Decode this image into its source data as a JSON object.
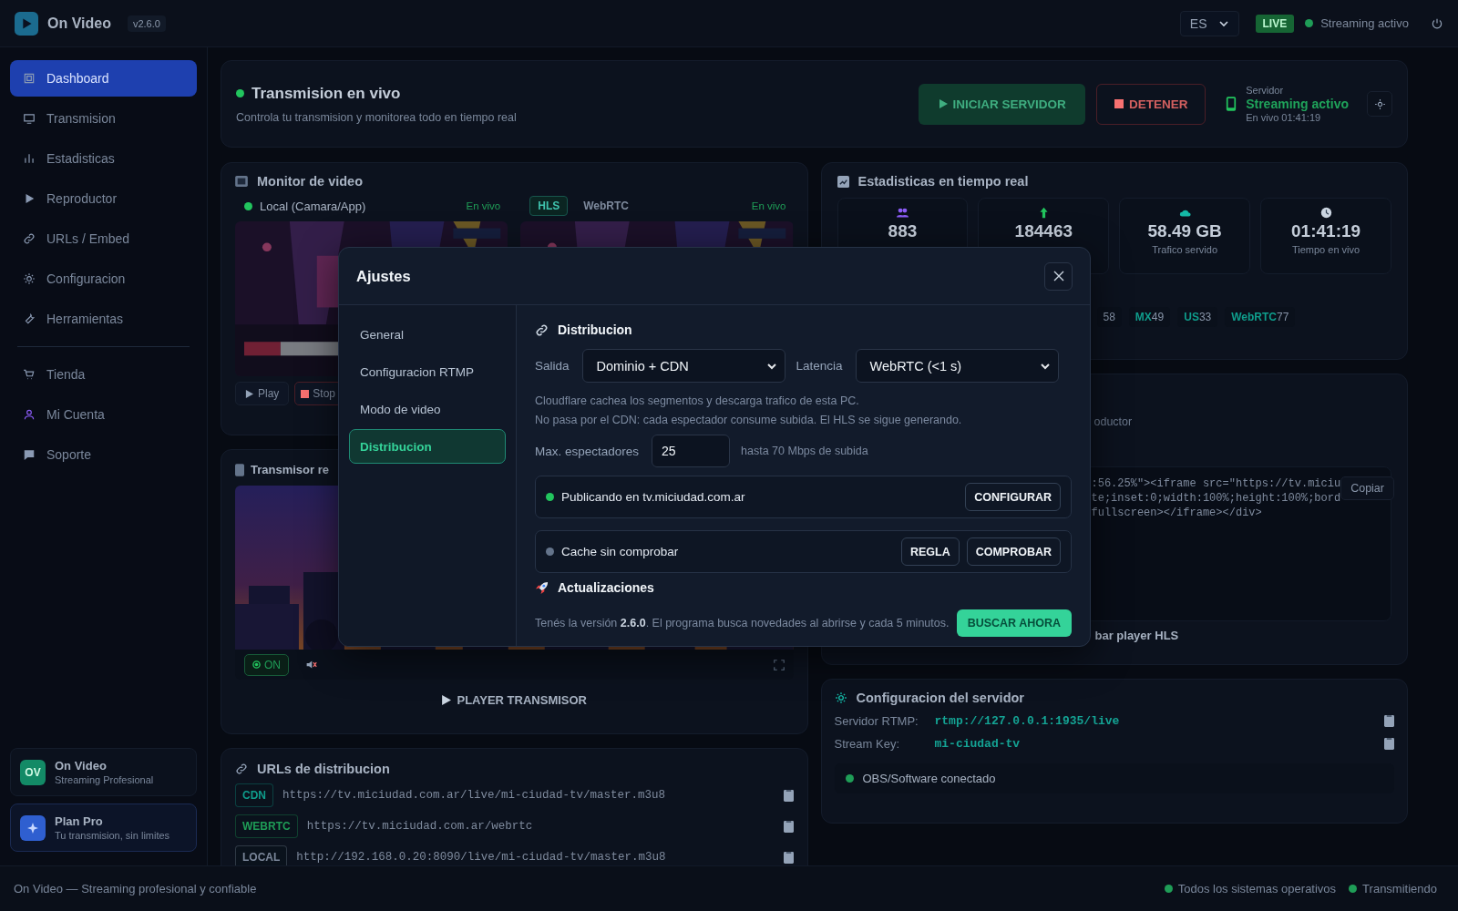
{
  "app": {
    "name": "On Video",
    "version": "v2.6.0"
  },
  "topbar": {
    "language": "ES",
    "live_badge": "LIVE",
    "status": {
      "label": "Streaming activo",
      "color": "#1f9d57"
    }
  },
  "sidebar": {
    "items": [
      {
        "label": "Dashboard",
        "selected": true
      },
      {
        "label": "Transmision",
        "selected": false
      },
      {
        "label": "Estadisticas",
        "selected": false
      },
      {
        "label": "Reproductor",
        "selected": false
      },
      {
        "label": "URLs / Embed",
        "selected": false
      },
      {
        "label": "Configuracion",
        "selected": false
      },
      {
        "label": "Herramientas",
        "selected": false
      }
    ],
    "secondary_items": [
      {
        "label": "Tienda",
        "selected": false
      },
      {
        "label": "Mi Cuenta",
        "selected": false
      },
      {
        "label": "Soporte",
        "selected": false
      }
    ],
    "cards": [
      {
        "kind": "initials",
        "initials": "OV",
        "title": "On Video",
        "subtitle": "Streaming Profesional"
      },
      {
        "kind": "plan",
        "title": "Plan Pro",
        "subtitle": "Tu transmision, sin limites"
      }
    ]
  },
  "header": {
    "title": "Transmision en vivo",
    "subtitle": "Controla tu transmision y monitorea todo en tiempo real",
    "start_button": "INICIAR SERVIDOR",
    "stop_button": "DETENER",
    "server": {
      "label": "Servidor",
      "status": "Streaming activo",
      "uptime": "En vivo 01:41:19"
    }
  },
  "monitor": {
    "title": "Monitor de video",
    "panes": [
      {
        "kind": "source",
        "label": "Local (Camara/App)",
        "status": "En vivo"
      },
      {
        "kind": "tabs",
        "tabs": [
          {
            "label": "HLS",
            "selected": true
          },
          {
            "label": "WebRTC",
            "selected": false
          }
        ],
        "status": "En vivo"
      }
    ],
    "controls": [
      {
        "kind": "play",
        "label": "Play"
      },
      {
        "kind": "stop",
        "label": "Stop"
      }
    ]
  },
  "transmitter": {
    "title": "Transmisor re",
    "toggle": {
      "label": "ON",
      "on": true
    },
    "player_button": "PLAYER TRANSMISOR"
  },
  "urls": {
    "title": "URLs de distribucion",
    "rows": [
      {
        "tag": "CDN",
        "url": "https://tv.miciudad.com.ar/live/mi-ciudad-tv/master.m3u8",
        "color": "#0f9d8c"
      },
      {
        "tag": "WEBRTC",
        "url": "https://tv.miciudad.com.ar/webrtc",
        "color": "#1f9d57"
      },
      {
        "tag": "LOCAL",
        "url": "http://192.168.0.20:8090/live/mi-ciudad-tv/master.m3u8",
        "color": "#7b879a"
      }
    ]
  },
  "stats": {
    "title": "Estadisticas en tiempo real",
    "tiles": [
      {
        "value": "883"
      },
      {
        "value": "184463"
      },
      {
        "value": "58.49 GB",
        "label": "Trafico servido"
      },
      {
        "value": "01:41:19",
        "label": "Tiempo en vivo"
      }
    ],
    "chips": [
      {
        "value": "58"
      },
      {
        "code": "MX",
        "value": "49"
      },
      {
        "code": "US",
        "value": "33"
      },
      {
        "code": "WebRTC",
        "value": "77"
      }
    ]
  },
  "embed": {
    "subtitle": "oductor",
    "code_lines": [
      ":56.25%\"><iframe src=\"https://tv.miciu",
      "te;inset:0;width:100%;height:100%;bord",
      "fullscreen></iframe></div>"
    ],
    "copy_button": "Copiar",
    "test_button": "bar player HLS"
  },
  "server_config": {
    "title": "Configuracion del servidor",
    "fields": [
      {
        "label": "Servidor RTMP:",
        "value": "rtmp://127.0.0.1:1935/live"
      },
      {
        "label": "Stream Key:",
        "value": "mi-ciudad-tv"
      }
    ],
    "connection": {
      "label": "OBS/Software conectado",
      "color": "#1f9d57"
    }
  },
  "footer": {
    "text": "On Video — Streaming profesional y confiable",
    "statuses": [
      {
        "label": "Todos los sistemas operativos",
        "color": "#1f9d57"
      },
      {
        "label": "Transmitiendo",
        "color": "#1f9d57"
      }
    ]
  },
  "settings_dialog": {
    "title": "Ajustes",
    "nav": [
      {
        "label": "General",
        "selected": false
      },
      {
        "label": "Configuracion RTMP",
        "selected": false
      },
      {
        "label": "Modo de video",
        "selected": false
      },
      {
        "label": "Distribucion",
        "selected": true
      }
    ],
    "section": {
      "title": "Distribucion",
      "output_label": "Salida",
      "output_value": "Dominio + CDN",
      "latency_label": "Latencia",
      "latency_value": "WebRTC (<1 s)",
      "hints": [
        "Cloudflare cachea los segmentos y descarga trafico de esta PC.",
        "No pasa por el CDN: cada espectador consume subida. El HLS se sigue generando."
      ],
      "viewers_label": "Max. espectadores",
      "viewers_value": "25",
      "viewers_hint": "hasta 70 Mbps de subida",
      "checks": [
        {
          "label": "Publicando en tv.miciudad.com.ar",
          "color": "#22c55e",
          "actions": [
            "CONFIGURAR"
          ]
        },
        {
          "label": "Cache sin comprobar",
          "color": "#64748b",
          "actions": [
            "REGLA",
            "COMPROBAR"
          ]
        }
      ]
    },
    "updates": {
      "title": "Actualizaciones",
      "text": "Tenés la versión **2.6.0**. El programa busca novedades al abrirse y cada 5 minutos.",
      "button": "BUSCAR AHORA"
    }
  }
}
